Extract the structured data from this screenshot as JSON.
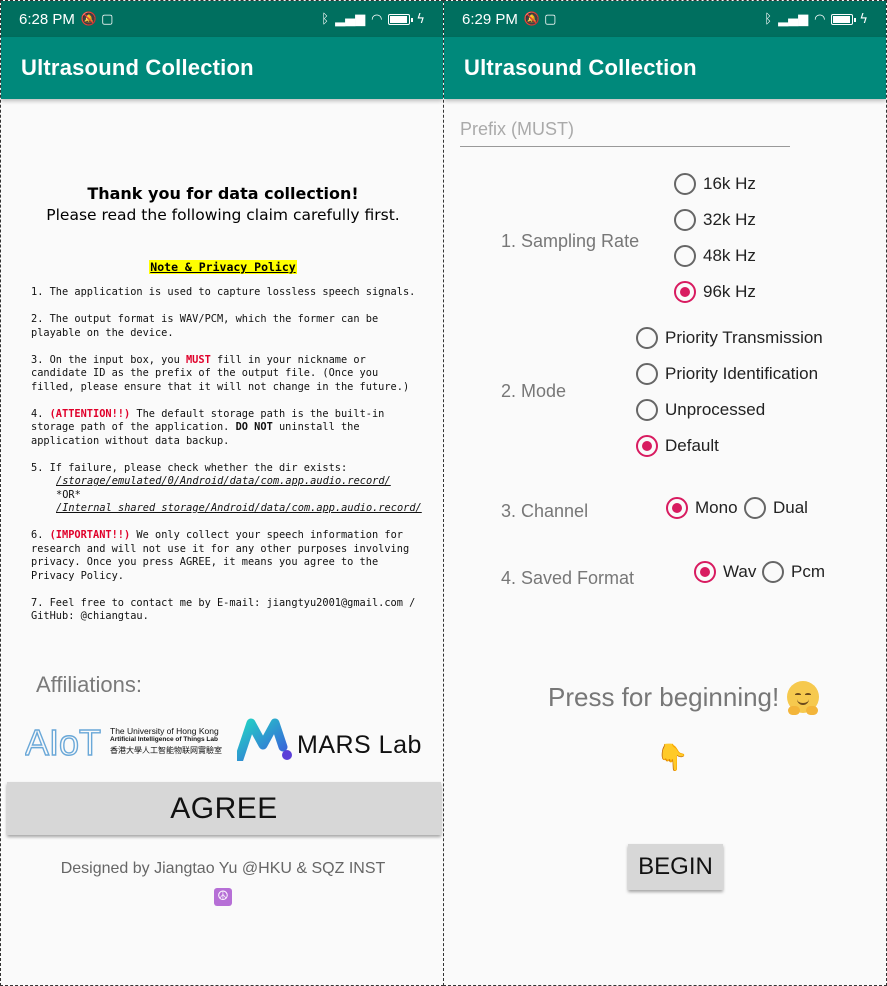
{
  "left_screen": {
    "status": {
      "time": "6:28 PM"
    },
    "app_title": "Ultrasound Collection",
    "intro": {
      "heading": "Thank you for data collection!",
      "subheading": "Please read the following claim carefully first."
    },
    "note_title": "Note & Privacy Policy",
    "policy": {
      "p1": "1. The application is used to capture lossless speech signals.",
      "p2": "2. The output format is WAV/PCM, which the former can be\nplayable on the device.",
      "p3_a": "3. On the input box, you ",
      "p3_must": "MUST",
      "p3_b": " fill in your nickname or\ncandidate ID as the prefix of the output file. (Once you\nfilled, please ensure that it will not change in the future.)",
      "p4_a": "4. ",
      "p4_attention": "(ATTENTION!!)",
      "p4_b": " The default storage path is the built-in\nstorage path of the application. ",
      "p4_donot": "DO NOT",
      "p4_c": " uninstall the\napplication without data backup.",
      "p5": "5. If failure, please check whether the dir exists:",
      "p5_path1": "/storage/emulated/0/Android/data/com.app.audio.record/",
      "p5_or": "*OR*",
      "p5_path2": "/Internal shared storage/Android/data/com.app.audio.record/",
      "p6_a": "6. ",
      "p6_important": "(IMPORTANT!!)",
      "p6_b": " We only collect your speech information for\nresearch and will not use it for any other purposes involving\nprivacy. Once you press AGREE, it means you agree to the\nPrivacy Policy.",
      "p7": "7. Feel free to contact me by E-mail: jiangtyu2001@gmail.com /\nGitHub: @chiangtau."
    },
    "affiliations_label": "Affiliations:",
    "logos": {
      "aiot_letters": "AIoT",
      "aiot_line1": "The University of Hong Kong",
      "aiot_line2": "Artificial Intelligence of Things Lab",
      "aiot_line3": "香港大學人工智能物联网實驗室",
      "mars": "MARS Lab"
    },
    "agree_label": "AGREE",
    "designed_by": "Designed by Jiangtao Yu @HKU & SQZ INST",
    "peace_symbol": "☮"
  },
  "right_screen": {
    "status": {
      "time": "6:29 PM"
    },
    "app_title": "Ultrasound Collection",
    "prefix_placeholder": "Prefix (MUST)",
    "sampling_rate": {
      "label": "1. Sampling Rate",
      "options": [
        "16k Hz",
        "32k Hz",
        "48k Hz",
        "96k Hz"
      ],
      "selected": "96k Hz"
    },
    "mode": {
      "label": "2. Mode",
      "options": [
        "Priority Transmission",
        "Priority Identification",
        "Unprocessed",
        "Default"
      ],
      "selected": "Default"
    },
    "channel": {
      "label": "3. Channel",
      "options": [
        "Mono",
        "Dual"
      ],
      "selected": "Mono"
    },
    "saved_format": {
      "label": "4. Saved Format",
      "options": [
        "Wav",
        "Pcm"
      ],
      "selected": "Wav"
    },
    "press_text": "Press for beginning!",
    "pointing_emoji": "👇",
    "begin_label": "BEGIN"
  },
  "colors": {
    "status_bar": "#006f5f",
    "app_bar": "#00897b",
    "radio_accent": "#d81b60",
    "note_highlight": "#ffff00",
    "warning_red": "#e0002a"
  }
}
